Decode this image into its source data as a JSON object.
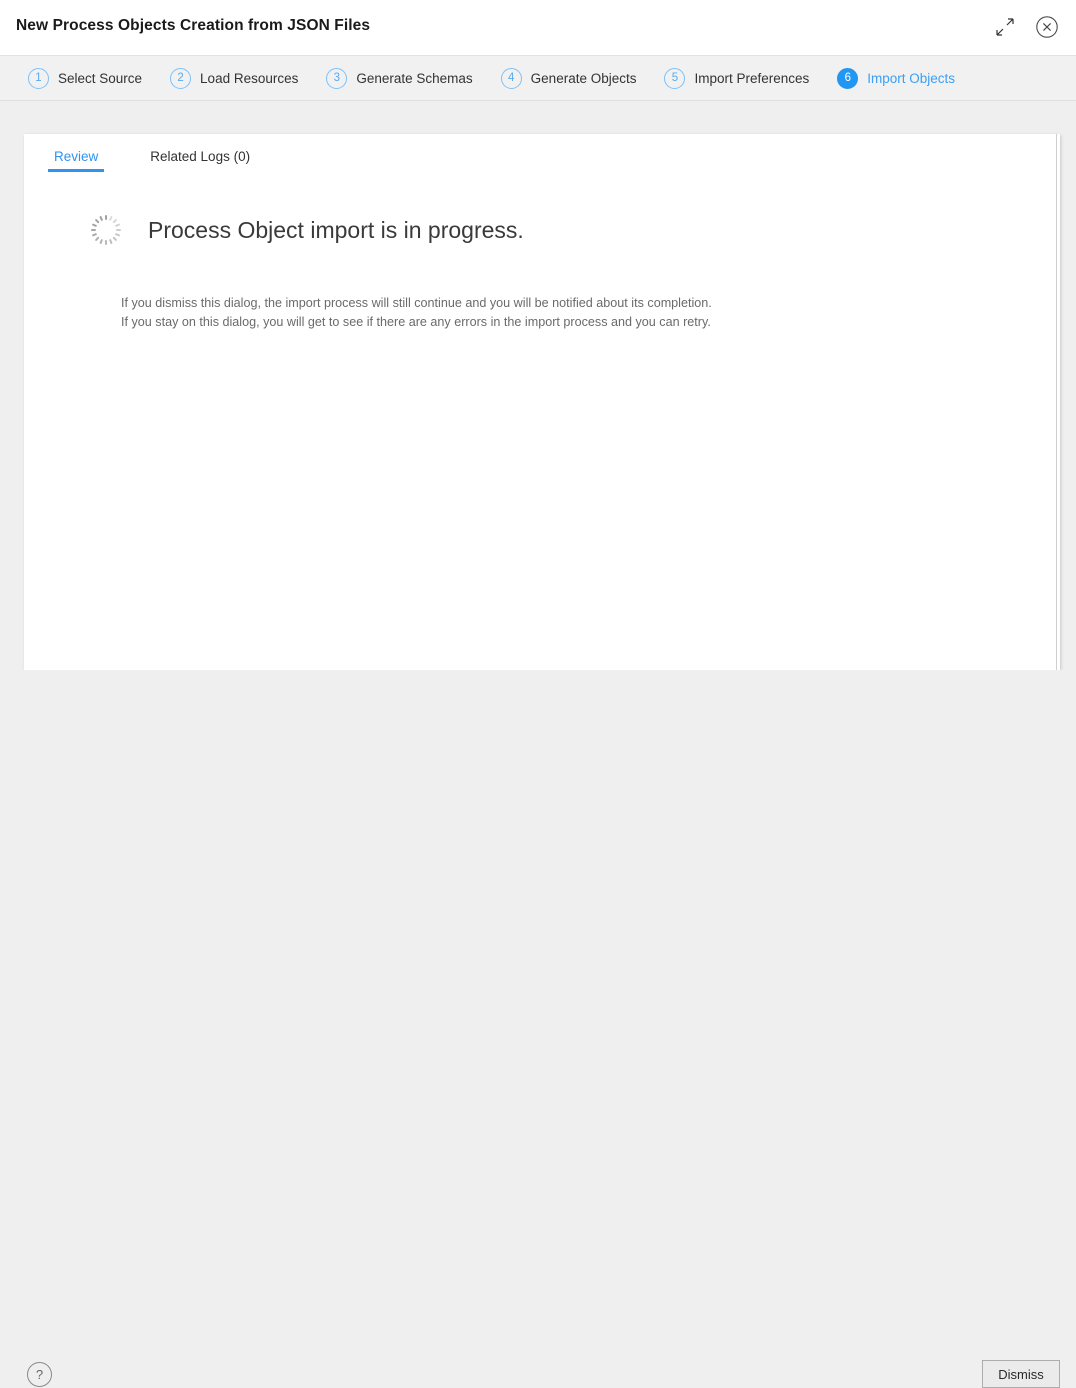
{
  "window": {
    "title": "New Process Objects Creation from JSON Files",
    "expand_icon": "expand-diagonal-icon",
    "close_icon": "close-circle-icon"
  },
  "wizard": {
    "steps": [
      {
        "number": "1",
        "label": "Select Source",
        "active": false
      },
      {
        "number": "2",
        "label": "Load Resources",
        "active": false
      },
      {
        "number": "3",
        "label": "Generate Schemas",
        "active": false
      },
      {
        "number": "4",
        "label": "Generate Objects",
        "active": false
      },
      {
        "number": "5",
        "label": "Import Preferences",
        "active": false
      },
      {
        "number": "6",
        "label": "Import Objects",
        "active": true
      }
    ],
    "active_color": "#2196f3",
    "inactive_border_color": "#7ec0f7"
  },
  "card": {
    "tabs": [
      {
        "label": "Review",
        "active": true
      },
      {
        "label": "Related Logs (0)",
        "active": false
      }
    ],
    "status": {
      "spinner_icon": "loading-spinner-icon",
      "heading": "Process Object import is in progress."
    },
    "description": {
      "line1": "If you dismiss this dialog, the import process will still continue and you will be notified about its completion.",
      "line2": "If you stay on this dialog, you will get to see if there are any errors in the import process and you can retry."
    }
  },
  "footer": {
    "help_icon": "help-circle-icon",
    "help_label": "?",
    "dismiss_label": "Dismiss"
  }
}
